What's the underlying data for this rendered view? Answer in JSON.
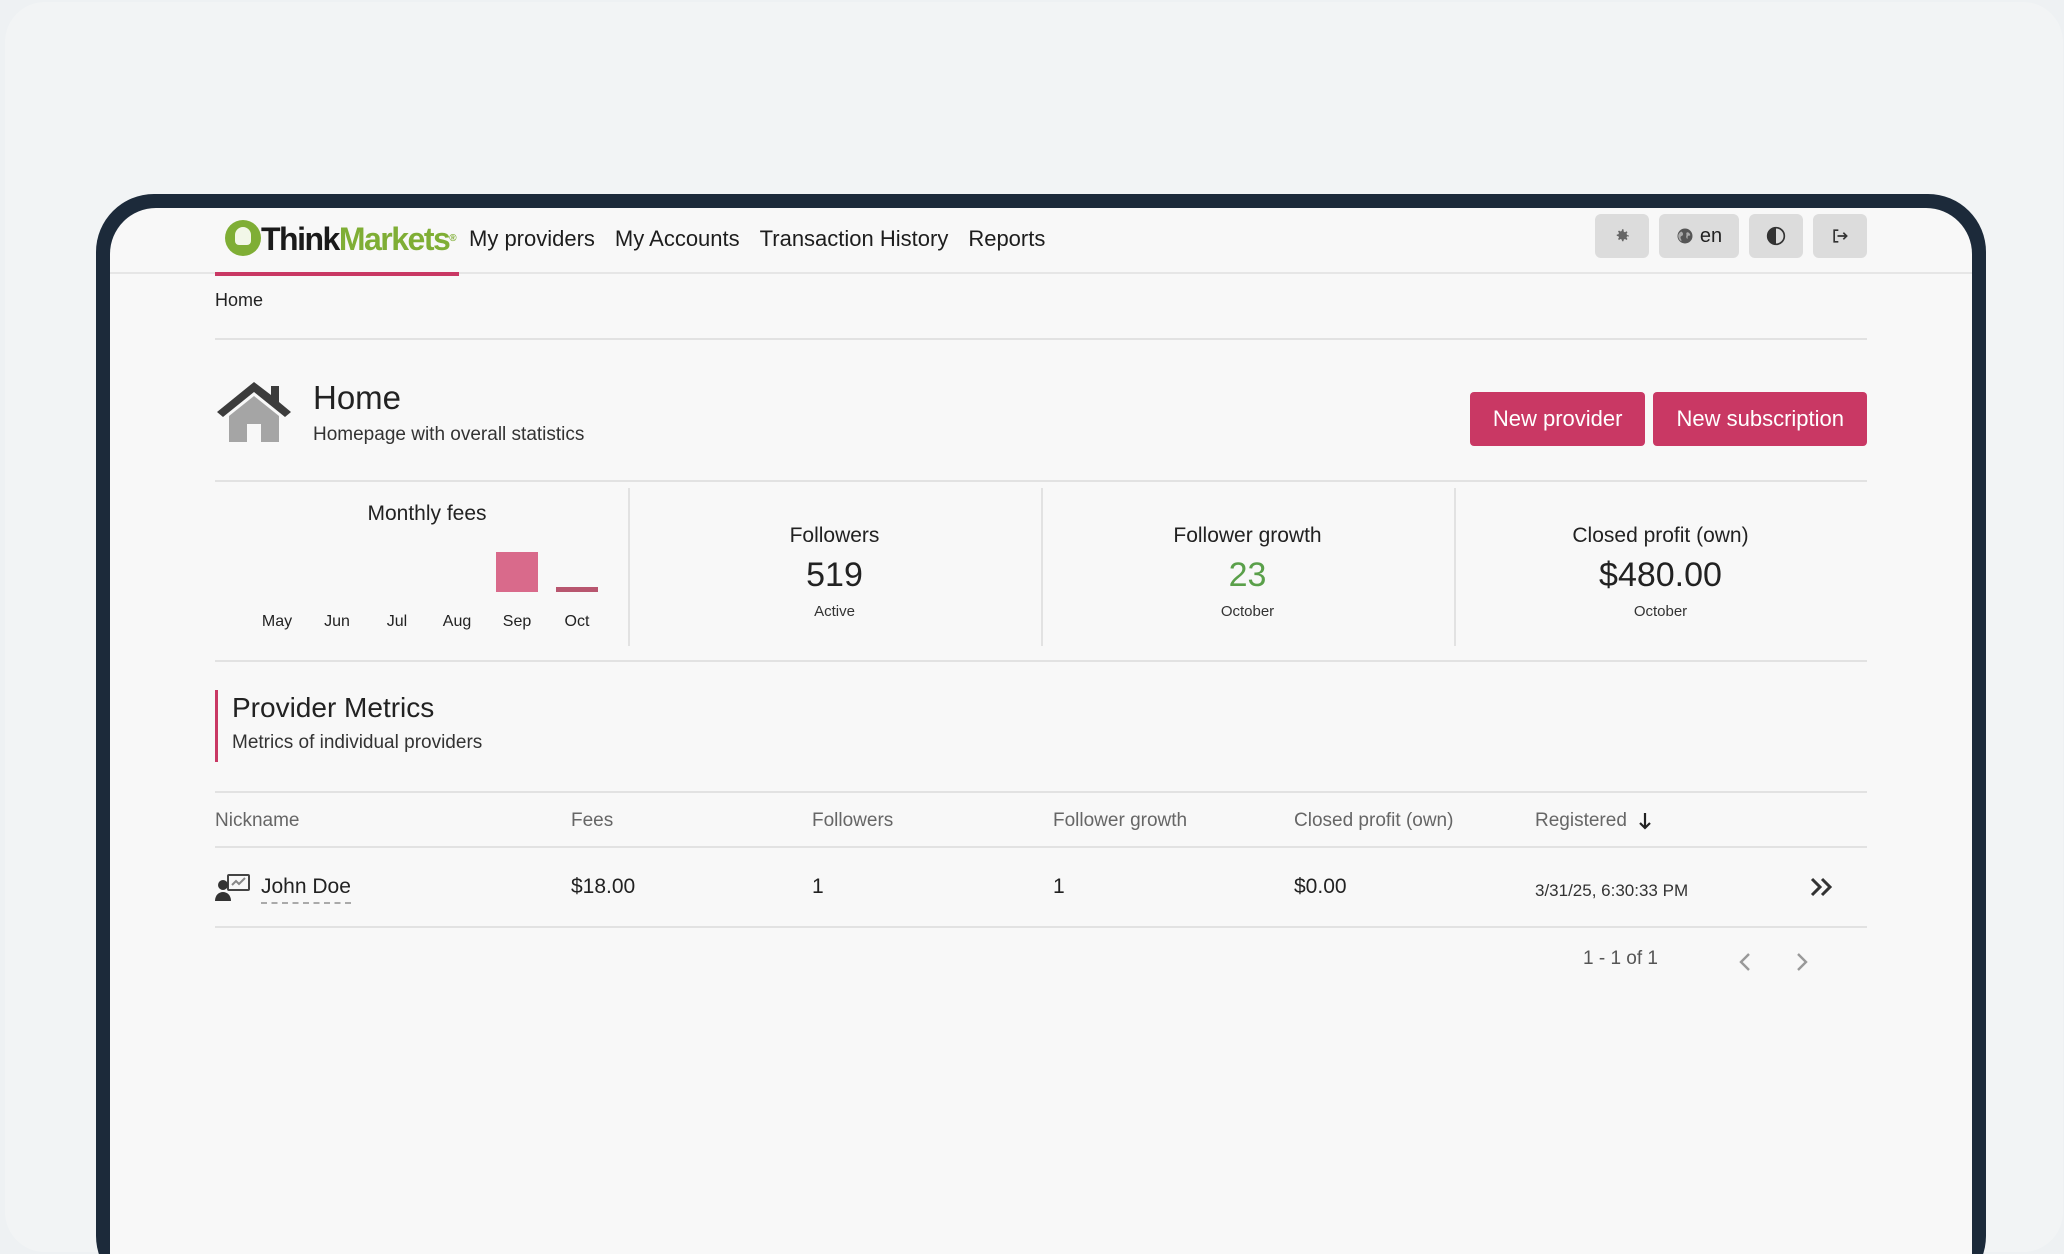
{
  "nav": {
    "logo_text_1": "Think",
    "logo_text_2": "Markets",
    "logo_reg": "®",
    "links": [
      "My providers",
      "My Accounts",
      "Transaction History",
      "Reports"
    ],
    "lang_label": "en"
  },
  "breadcrumb": "Home",
  "header": {
    "title": "Home",
    "subtitle": "Homepage with overall statistics",
    "btn_new_provider": "New provider",
    "btn_new_subscription": "New subscription"
  },
  "stats": {
    "monthly_fees": {
      "label": "Monthly fees"
    },
    "followers": {
      "label": "Followers",
      "value": "519",
      "sub": "Active"
    },
    "follower_growth": {
      "label": "Follower growth",
      "value": "23",
      "sub": "October"
    },
    "closed_profit": {
      "label": "Closed profit (own)",
      "value": "$480.00",
      "sub": "October"
    }
  },
  "chart_data": {
    "type": "bar",
    "title": "Monthly fees",
    "categories": [
      "May",
      "Jun",
      "Jul",
      "Aug",
      "Sep",
      "Oct"
    ],
    "values": [
      0,
      0,
      0,
      0,
      480,
      18
    ],
    "colors": [
      "#d96a8b",
      "#d96a8b",
      "#d96a8b",
      "#d96a8b",
      "#d96a8b",
      "#b8566f"
    ],
    "grid": false
  },
  "section": {
    "title": "Provider Metrics",
    "subtitle": "Metrics of individual providers"
  },
  "table": {
    "columns": [
      "Nickname",
      "Fees",
      "Followers",
      "Follower growth",
      "Closed profit (own)",
      "Registered"
    ],
    "rows": [
      {
        "nickname": "John Doe",
        "fees": "$18.00",
        "followers": "1",
        "growth": "1",
        "profit": "$0.00",
        "registered": "3/31/25, 6:30:33 PM"
      }
    ]
  },
  "pager": {
    "text": "1 - 1 of 1"
  },
  "colors": {
    "accent": "#c93864",
    "brand_green": "#7fae35",
    "positive": "#5aa04a"
  }
}
